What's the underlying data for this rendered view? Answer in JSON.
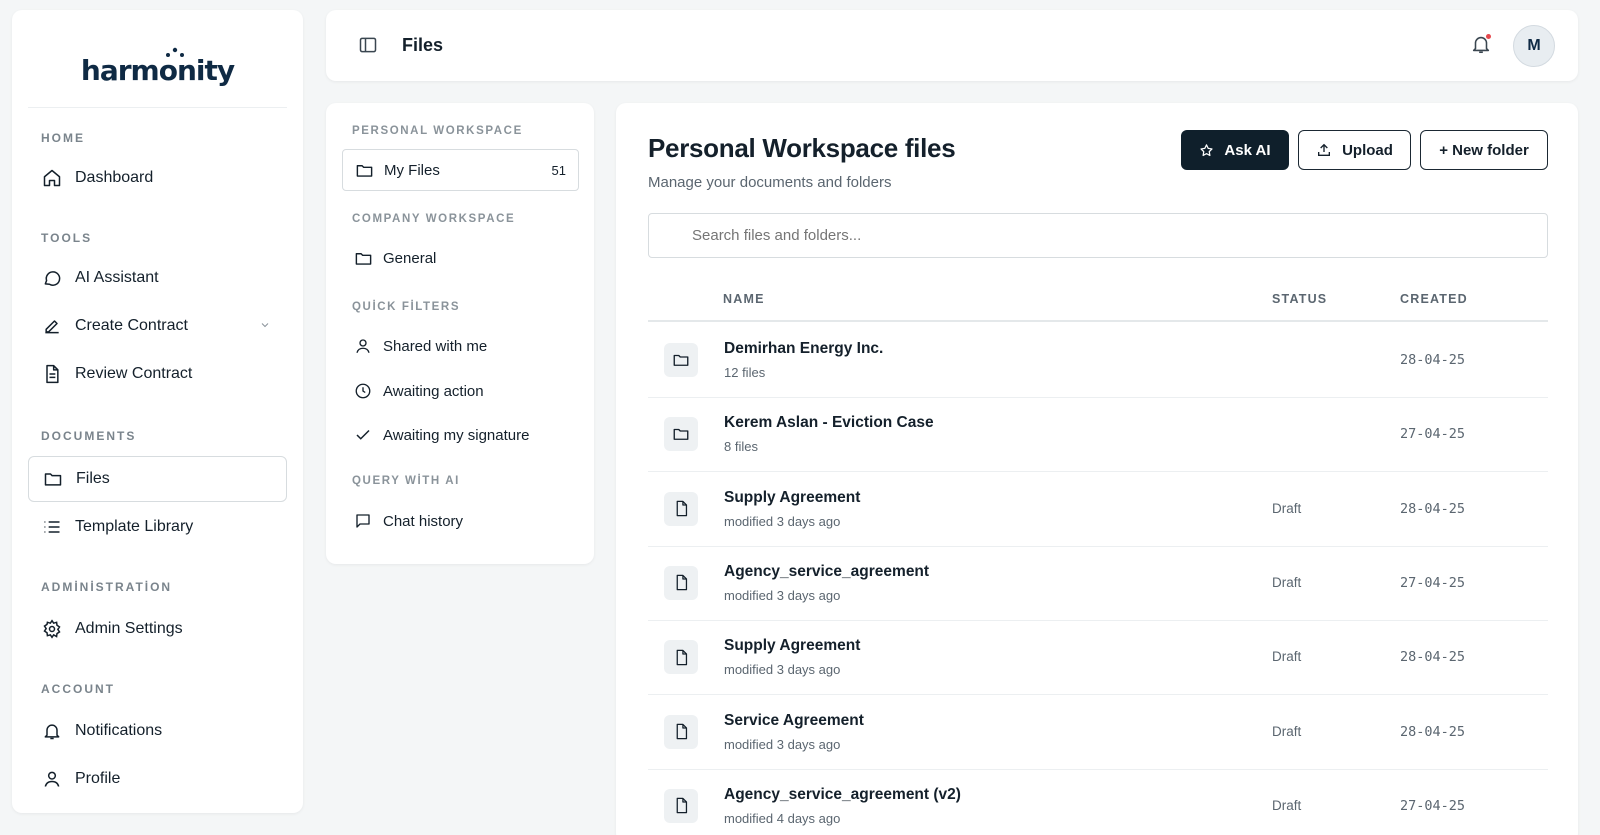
{
  "brand": {
    "name": "harmonity"
  },
  "sidebar": {
    "sections": [
      {
        "title": "HOME",
        "items": [
          {
            "label": "Dashboard",
            "icon": "home-icon"
          }
        ]
      },
      {
        "title": "TOOLS",
        "items": [
          {
            "label": "AI Assistant",
            "icon": "chat-bubble-icon"
          },
          {
            "label": "Create Contract",
            "icon": "pencil-icon"
          },
          {
            "label": "Review Contract",
            "icon": "document-icon"
          }
        ]
      },
      {
        "title": "DOCUMENTS",
        "items": [
          {
            "label": "Files",
            "icon": "folder-icon"
          },
          {
            "label": "Template Library",
            "icon": "list-icon"
          }
        ]
      },
      {
        "title": "ADMİNİSTRATİON",
        "items": [
          {
            "label": "Admin Settings",
            "icon": "gear-icon"
          }
        ]
      },
      {
        "title": "ACCOUNT",
        "items": [
          {
            "label": "Notifications",
            "icon": "bell-icon"
          },
          {
            "label": "Profile",
            "icon": "user-icon"
          }
        ]
      }
    ],
    "active": "Files"
  },
  "header": {
    "title": "Files",
    "avatar_initial": "M"
  },
  "workspace_nav": {
    "personal_title": "PERSONAL WORKSPACE",
    "my_files": {
      "label": "My Files",
      "count": "51"
    },
    "company_title": "COMPANY WORKSPACE",
    "general": {
      "label": "General"
    },
    "filters_title": "QUİCK FİLTERS",
    "filters": [
      "Shared with me",
      "Awaiting action",
      "Awaiting my signature"
    ],
    "ai_title": "QUERY WİTH AI",
    "chat_history": "Chat history"
  },
  "main": {
    "title": "Personal Workspace files",
    "subtitle": "Manage your documents and folders",
    "buttons": {
      "ask_ai": "Ask AI",
      "upload": "Upload",
      "new_folder": "+ New folder"
    },
    "search_placeholder": "Search files and folders...",
    "columns": {
      "name": "NAME",
      "status": "STATUS",
      "created": "CREATED"
    },
    "rows": [
      {
        "type": "folder",
        "name": "Demirhan Energy Inc.",
        "meta": "12 files",
        "status": "",
        "created": "28-04-25"
      },
      {
        "type": "folder",
        "name": "Kerem Aslan - Eviction Case",
        "meta": "8 files",
        "status": "",
        "created": "27-04-25"
      },
      {
        "type": "file",
        "name": "Supply Agreement",
        "meta": "modified 3 days ago",
        "status": "Draft",
        "created": "28-04-25"
      },
      {
        "type": "file",
        "name": "Agency_service_agreement",
        "meta": "modified 3 days ago",
        "status": "Draft",
        "created": "27-04-25"
      },
      {
        "type": "file",
        "name": "Supply Agreement",
        "meta": "modified 3 days ago",
        "status": "Draft",
        "created": "28-04-25"
      },
      {
        "type": "file",
        "name": "Service Agreement",
        "meta": "modified 3 days ago",
        "status": "Draft",
        "created": "28-04-25"
      },
      {
        "type": "file",
        "name": "Agency_service_agreement (v2)",
        "meta": "modified 4 days ago",
        "status": "Draft",
        "created": "27-04-25"
      }
    ]
  },
  "colors": {
    "primary_dark": "#0f1f2b",
    "brand": "#0f2a44",
    "notification_dot": "#e5484d"
  }
}
